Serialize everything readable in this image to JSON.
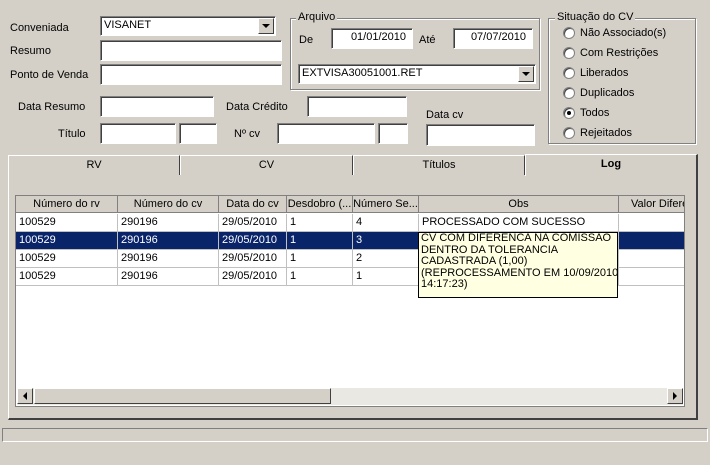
{
  "filters": {
    "conveniada_label": "Conveniada",
    "conveniada_value": "VISANET",
    "resumo_label": "Resumo",
    "ponto_venda_label": "Ponto de Venda",
    "data_resumo_label": "Data Resumo",
    "data_credito_label": "Data Crédito",
    "data_cv_label": "Data cv",
    "titulo_label": "Título",
    "nr_cv_label": "Nº cv"
  },
  "arquivo": {
    "title": "Arquivo",
    "de_label": "De",
    "de_value": "01/01/2010",
    "ate_label": "Até",
    "ate_value": "07/07/2010",
    "file_value": "EXTVISA30051001.RET"
  },
  "situacao": {
    "title": "Situação do CV",
    "options": [
      "Não Associado(s)",
      "Com Restrições",
      "Liberados",
      "Duplicados",
      "Todos",
      "Rejeitados"
    ],
    "selected": "Todos"
  },
  "tabs": [
    "RV",
    "CV",
    "Títulos",
    "Log"
  ],
  "active_tab": "Log",
  "grid": {
    "columns": [
      "Número do rv",
      "Número do cv",
      "Data do cv",
      "Desdobro (...",
      "Número Se...",
      "Obs",
      "Valor Difere"
    ],
    "rows": [
      [
        "100529",
        "290196",
        "29/05/2010",
        "1",
        "4",
        "PROCESSADO COM SUCESSO",
        ""
      ],
      [
        "100529",
        "290196",
        "29/05/2010",
        "1",
        "3",
        "",
        ""
      ],
      [
        "100529",
        "290196",
        "29/05/2010",
        "1",
        "2",
        "",
        ""
      ],
      [
        "100529",
        "290196",
        "29/05/2010",
        "1",
        "1",
        "",
        ""
      ]
    ],
    "selected_row": 1,
    "tooltip": [
      "CV COM DIFERENCA NA COMISSAO",
      "DENTRO DA TOLERANCIA",
      "CADASTRADA  (1,00)",
      "(REPROCESSAMENTO EM 10/09/2010",
      "14:17:23)"
    ]
  }
}
